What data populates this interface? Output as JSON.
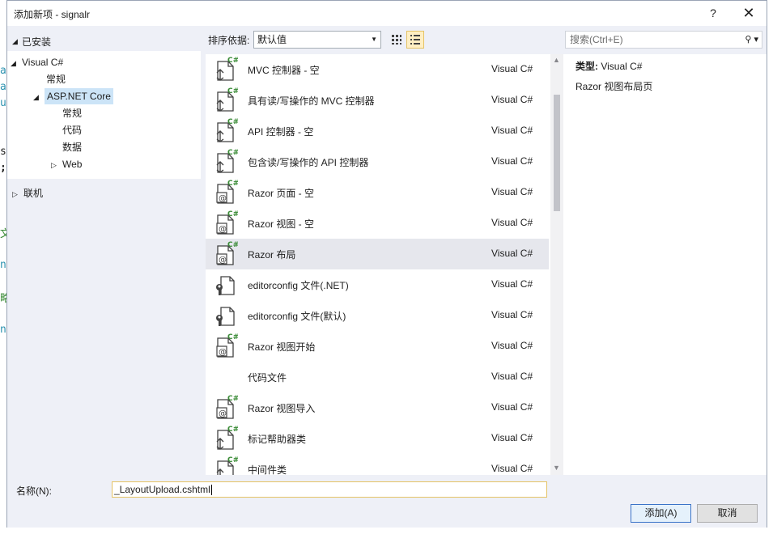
{
  "window": {
    "title": "添加新项 - signalr",
    "help_label": "?",
    "close_label": "✕"
  },
  "left_pane": {
    "installed_label": "已安装",
    "tree": [
      {
        "label": "Visual C#",
        "expanded": true
      },
      {
        "label": "常规"
      },
      {
        "label": "ASP.NET Core",
        "expanded": true,
        "selected": true
      },
      {
        "label": "常规"
      },
      {
        "label": "代码"
      },
      {
        "label": "数据"
      },
      {
        "label": "Web",
        "expandable": true
      }
    ],
    "online_label": "联机"
  },
  "toolbar": {
    "sort_label": "排序依据:",
    "sort_value": "默认值",
    "search_placeholder": "搜索(Ctrl+E)"
  },
  "items": [
    {
      "name": "MVC 控制器 - 空",
      "lang": "Visual C#",
      "icon": "controller-icon"
    },
    {
      "name": "具有读/写操作的 MVC 控制器",
      "lang": "Visual C#",
      "icon": "controller-icon"
    },
    {
      "name": "API 控制器 - 空",
      "lang": "Visual C#",
      "icon": "controller-icon"
    },
    {
      "name": "包含读/写操作的 API 控制器",
      "lang": "Visual C#",
      "icon": "controller-icon"
    },
    {
      "name": "Razor 页面 - 空",
      "lang": "Visual C#",
      "icon": "razor-icon"
    },
    {
      "name": "Razor 视图 - 空",
      "lang": "Visual C#",
      "icon": "razor-icon"
    },
    {
      "name": "Razor 布局",
      "lang": "Visual C#",
      "icon": "razor-icon",
      "selected": true
    },
    {
      "name": "editorconfig 文件(.NET)",
      "lang": "Visual C#",
      "icon": "config-file-icon"
    },
    {
      "name": "editorconfig 文件(默认)",
      "lang": "Visual C#",
      "icon": "config-file-icon"
    },
    {
      "name": "Razor 视图开始",
      "lang": "Visual C#",
      "icon": "razor-icon"
    },
    {
      "name": "代码文件",
      "lang": "Visual C#",
      "icon": "none"
    },
    {
      "name": "Razor 视图导入",
      "lang": "Visual C#",
      "icon": "razor-icon"
    },
    {
      "name": "标记帮助器类",
      "lang": "Visual C#",
      "icon": "controller-icon"
    },
    {
      "name": "中间件类",
      "lang": "Visual C#",
      "icon": "controller-icon"
    }
  ],
  "description": {
    "type_label": "类型:",
    "type_value": "Visual C#",
    "text": "Razor 视图布局页"
  },
  "bottom": {
    "name_label": "名称(N):",
    "name_value": "_LayoutUpload.cshtml",
    "add_label": "添加(A)",
    "cancel_label": "取消"
  },
  "colors": {
    "accent_selected": "#cce4f7",
    "pane_bg": "#eef0f7",
    "csharp_green": "#388a34"
  }
}
